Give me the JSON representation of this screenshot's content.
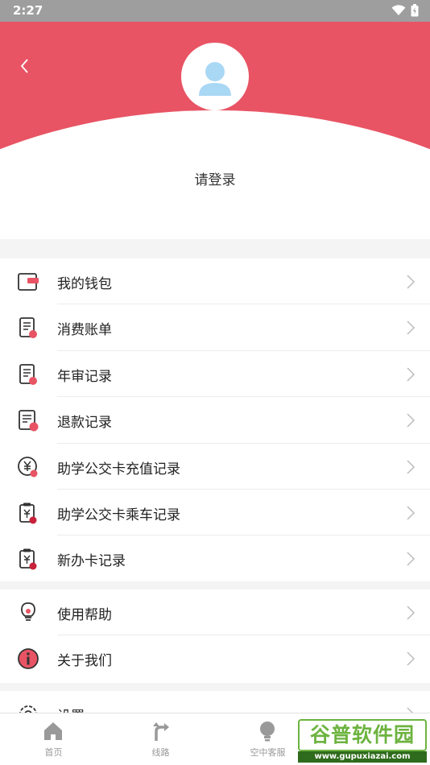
{
  "status_bar": {
    "time": "2:27"
  },
  "header": {
    "login_text": "请登录"
  },
  "menu_group_1": [
    {
      "label": "我的钱包",
      "icon": "wallet-icon"
    },
    {
      "label": "消费账单",
      "icon": "bill-icon"
    },
    {
      "label": "年审记录",
      "icon": "annual-review-icon"
    },
    {
      "label": "退款记录",
      "icon": "refund-icon"
    },
    {
      "label": "助学公交卡充值记录",
      "icon": "recharge-icon"
    },
    {
      "label": "助学公交卡乘车记录",
      "icon": "ride-record-icon"
    },
    {
      "label": "新办卡记录",
      "icon": "new-card-icon"
    }
  ],
  "menu_group_2": [
    {
      "label": "使用帮助",
      "icon": "help-bulb-icon"
    },
    {
      "label": "关于我们",
      "icon": "info-icon"
    }
  ],
  "menu_group_3": [
    {
      "label": "设置",
      "icon": "settings-gear-icon"
    }
  ],
  "tabbar": [
    {
      "label": "首页",
      "icon": "home-icon"
    },
    {
      "label": "线路",
      "icon": "route-icon"
    },
    {
      "label": "空中客服",
      "icon": "customer-service-icon"
    }
  ],
  "watermark": {
    "title": "谷普软件园",
    "url": "www.gupuxiazai.com"
  },
  "colors": {
    "accent": "#e85464",
    "divider": "#ececec",
    "tab_text": "#999999"
  }
}
